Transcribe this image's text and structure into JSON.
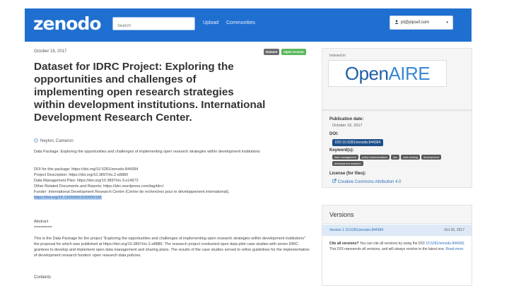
{
  "navbar": {
    "logo": "zenodo",
    "search_placeholder": "Search",
    "upload": "Upload",
    "communities": "Communities",
    "user_email": "pt@pipsef.com",
    "user_icon": "user-icon",
    "caret": "▾"
  },
  "record": {
    "date": "October 16, 2017",
    "badges": [
      "Dataset",
      "Open Access"
    ],
    "title": "Dataset for IDRC Project: Exploring the opportunities and challenges of implementing open research strategies within development institutions. International Development Research Center.",
    "author": "Neylon, Cameron",
    "description": "Data Package: Exploring the opportunities and challenges of implementing open research strategies within development institutions",
    "links": [
      "DOI for this package: https://doi.org/10.5281/zenodo.844394",
      "Project Description: https://doi.org/10.3897/rio.2.e8880",
      "Data Management Plan: https://doi.org/10.3897/rio.3.e14672",
      "Other Related Documents and Reports: https://idrc.wordpress.com/tag/idrc/",
      "Funder: International Development Research Centre (Centre de recherches pour le développement international),"
    ],
    "highlight_link": "https://doi.org/10.13039/501100000193",
    "abstract_heading": "Abstract",
    "abstract_rule": "========",
    "abstract": "This is the Data Package for the project \"Exploring the opportunities and challenges of implementing open research strategies within development institutions\" the proposal for which was published at https://doi.org/10.3897/rio.2.e8880. The research project conducted open data pilot case studies with seven IDRC grantees to develop and implement open data management and sharing plans. The results of the case studies served to refine guidelines for the implementation of development research funders' open research data policies.",
    "contents": "Contents"
  },
  "sidebar": {
    "indexed_in": "Indexed in",
    "openaire_open": "Open",
    "openaire_aire": "AIRE",
    "publication_date_label": "Publication date:",
    "publication_date": "October 16, 2017",
    "doi_label": "DOI:",
    "doi_badge": "DOI 10.5281/zenodo.844394",
    "keywords_label": "Keyword(s):",
    "keywords": [
      "data management",
      "policy implementation",
      "idrc",
      "data sharing",
      "development",
      "development research"
    ],
    "license_label": "License (for files):",
    "license": "Creative Commons Attribution 4.0",
    "license_icon": "external-link-icon",
    "versions_heading": "Versions",
    "version_entry": "Version 1 10.5281/zenodo.844394",
    "version_date": "Oct 16, 2017",
    "cite_all_bold": "Cite all versions?",
    "cite_all_text": " You can cite all versions by using the DOI ",
    "cite_all_doi": "10.5281/zenodo.844393",
    "cite_all_rest": ". This DOI represents all versions, and will always resolve to the latest one. ",
    "read_more": "Read more."
  }
}
